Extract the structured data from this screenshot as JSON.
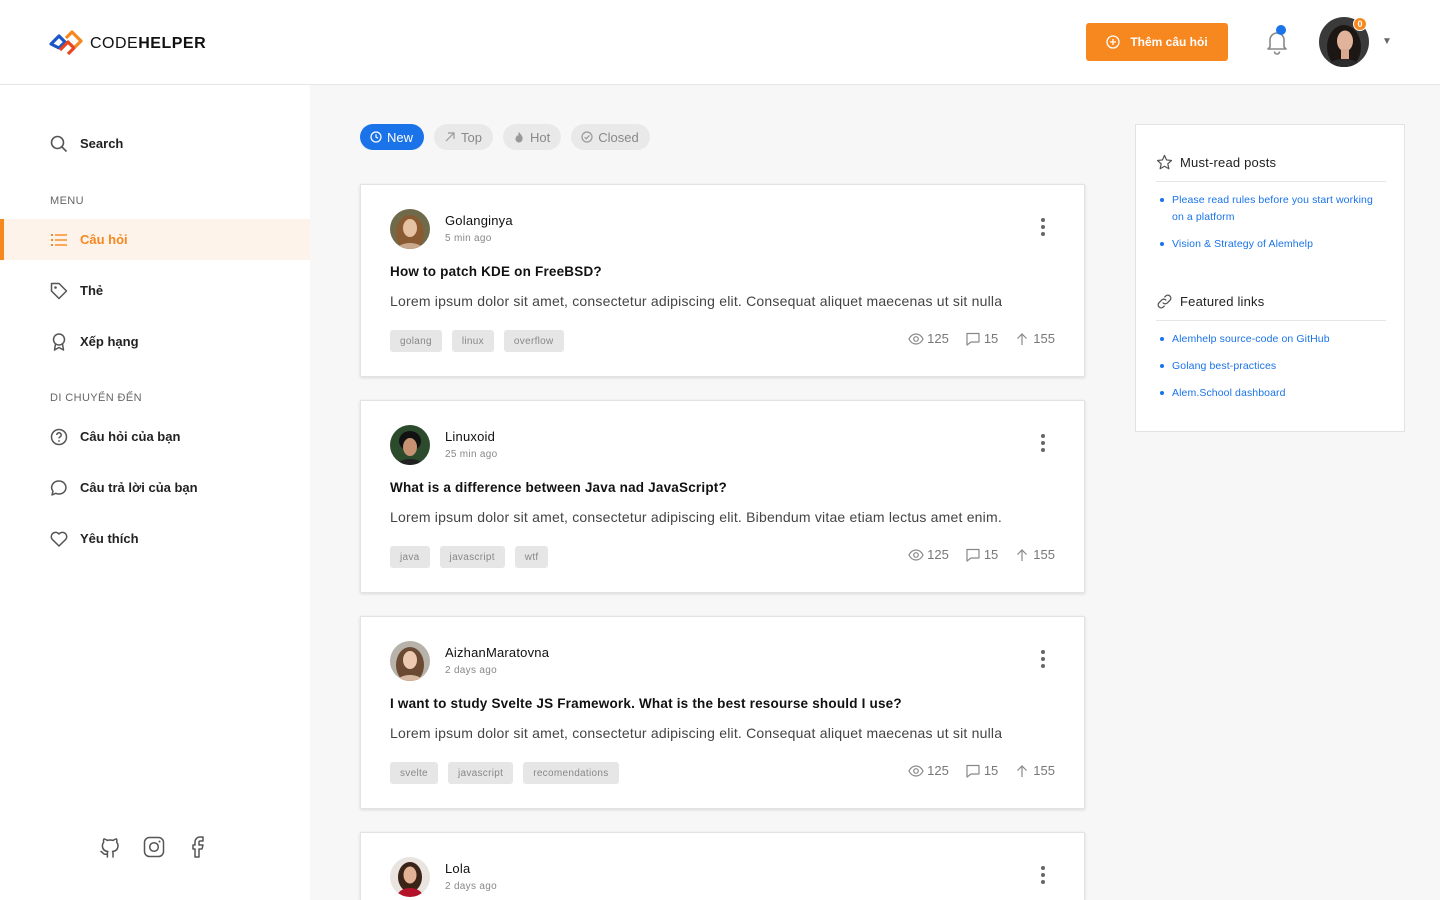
{
  "header": {
    "logo_light": "CODE",
    "logo_bold": "HELPER",
    "add_question_label": "Thêm câu hỏi",
    "notification_count": "0"
  },
  "sidebar": {
    "search_label": "Search",
    "menu_section": "MENU",
    "menu_items": [
      {
        "label": "Câu hỏi",
        "icon": "list-icon",
        "active": true
      },
      {
        "label": "Thẻ",
        "icon": "tag-icon"
      },
      {
        "label": "Xếp hạng",
        "icon": "award-icon"
      }
    ],
    "nav_section": "DI CHUYỂN ĐẾN",
    "nav_items": [
      {
        "label": "Câu hỏi của bạn",
        "icon": "question-circle-icon"
      },
      {
        "label": "Câu trả lời của bạn",
        "icon": "comment-icon"
      },
      {
        "label": "Yêu thích",
        "icon": "heart-icon"
      }
    ],
    "socials": [
      "github-icon",
      "instagram-icon",
      "facebook-icon"
    ]
  },
  "filters": [
    {
      "label": "New",
      "icon": "clock-icon",
      "active": true
    },
    {
      "label": "Top",
      "icon": "arrow-up-right-icon"
    },
    {
      "label": "Hot",
      "icon": "flame-icon"
    },
    {
      "label": "Closed",
      "icon": "check-circle-icon"
    }
  ],
  "posts": [
    {
      "author": "Golanginya",
      "time": "5 min ago",
      "title": "How to patch KDE on FreeBSD?",
      "excerpt": "Lorem ipsum dolor sit amet, consectetur adipiscing elit. Consequat aliquet maecenas ut sit nulla",
      "tags": [
        "golang",
        "linux",
        "overflow"
      ],
      "views": "125",
      "comments": "15",
      "votes": "155"
    },
    {
      "author": "Linuxoid",
      "time": "25 min ago",
      "title": "What is a difference between Java nad JavaScript?",
      "excerpt": "Lorem ipsum dolor sit amet, consectetur adipiscing elit. Bibendum vitae etiam lectus amet enim.",
      "tags": [
        "java",
        "javascript",
        "wtf"
      ],
      "views": "125",
      "comments": "15",
      "votes": "155"
    },
    {
      "author": "AizhanMaratovna",
      "time": "2 days ago",
      "title": "I want to study Svelte JS Framework. What is the best resourse should I use?",
      "excerpt": "Lorem ipsum dolor sit amet, consectetur adipiscing elit. Consequat aliquet maecenas ut sit nulla",
      "tags": [
        "svelte",
        "javascript",
        "recomendations"
      ],
      "views": "125",
      "comments": "15",
      "votes": "155"
    },
    {
      "author": "Lola",
      "time": "2 days ago",
      "title": "",
      "excerpt": "",
      "tags": [],
      "views": "",
      "comments": "",
      "votes": ""
    }
  ],
  "widget": {
    "must_read_title": "Must-read posts",
    "must_read": [
      "Please read rules before you start working on a platform",
      "Vision & Strategy of Alemhelp"
    ],
    "featured_title": "Featured links",
    "featured": [
      "Alemhelp source-code on GitHub",
      "Golang best-practices",
      "Alem.School dashboard"
    ]
  },
  "colors": {
    "accent": "#f7871f",
    "link": "#1a73e8",
    "background": "#f7f7f7"
  }
}
